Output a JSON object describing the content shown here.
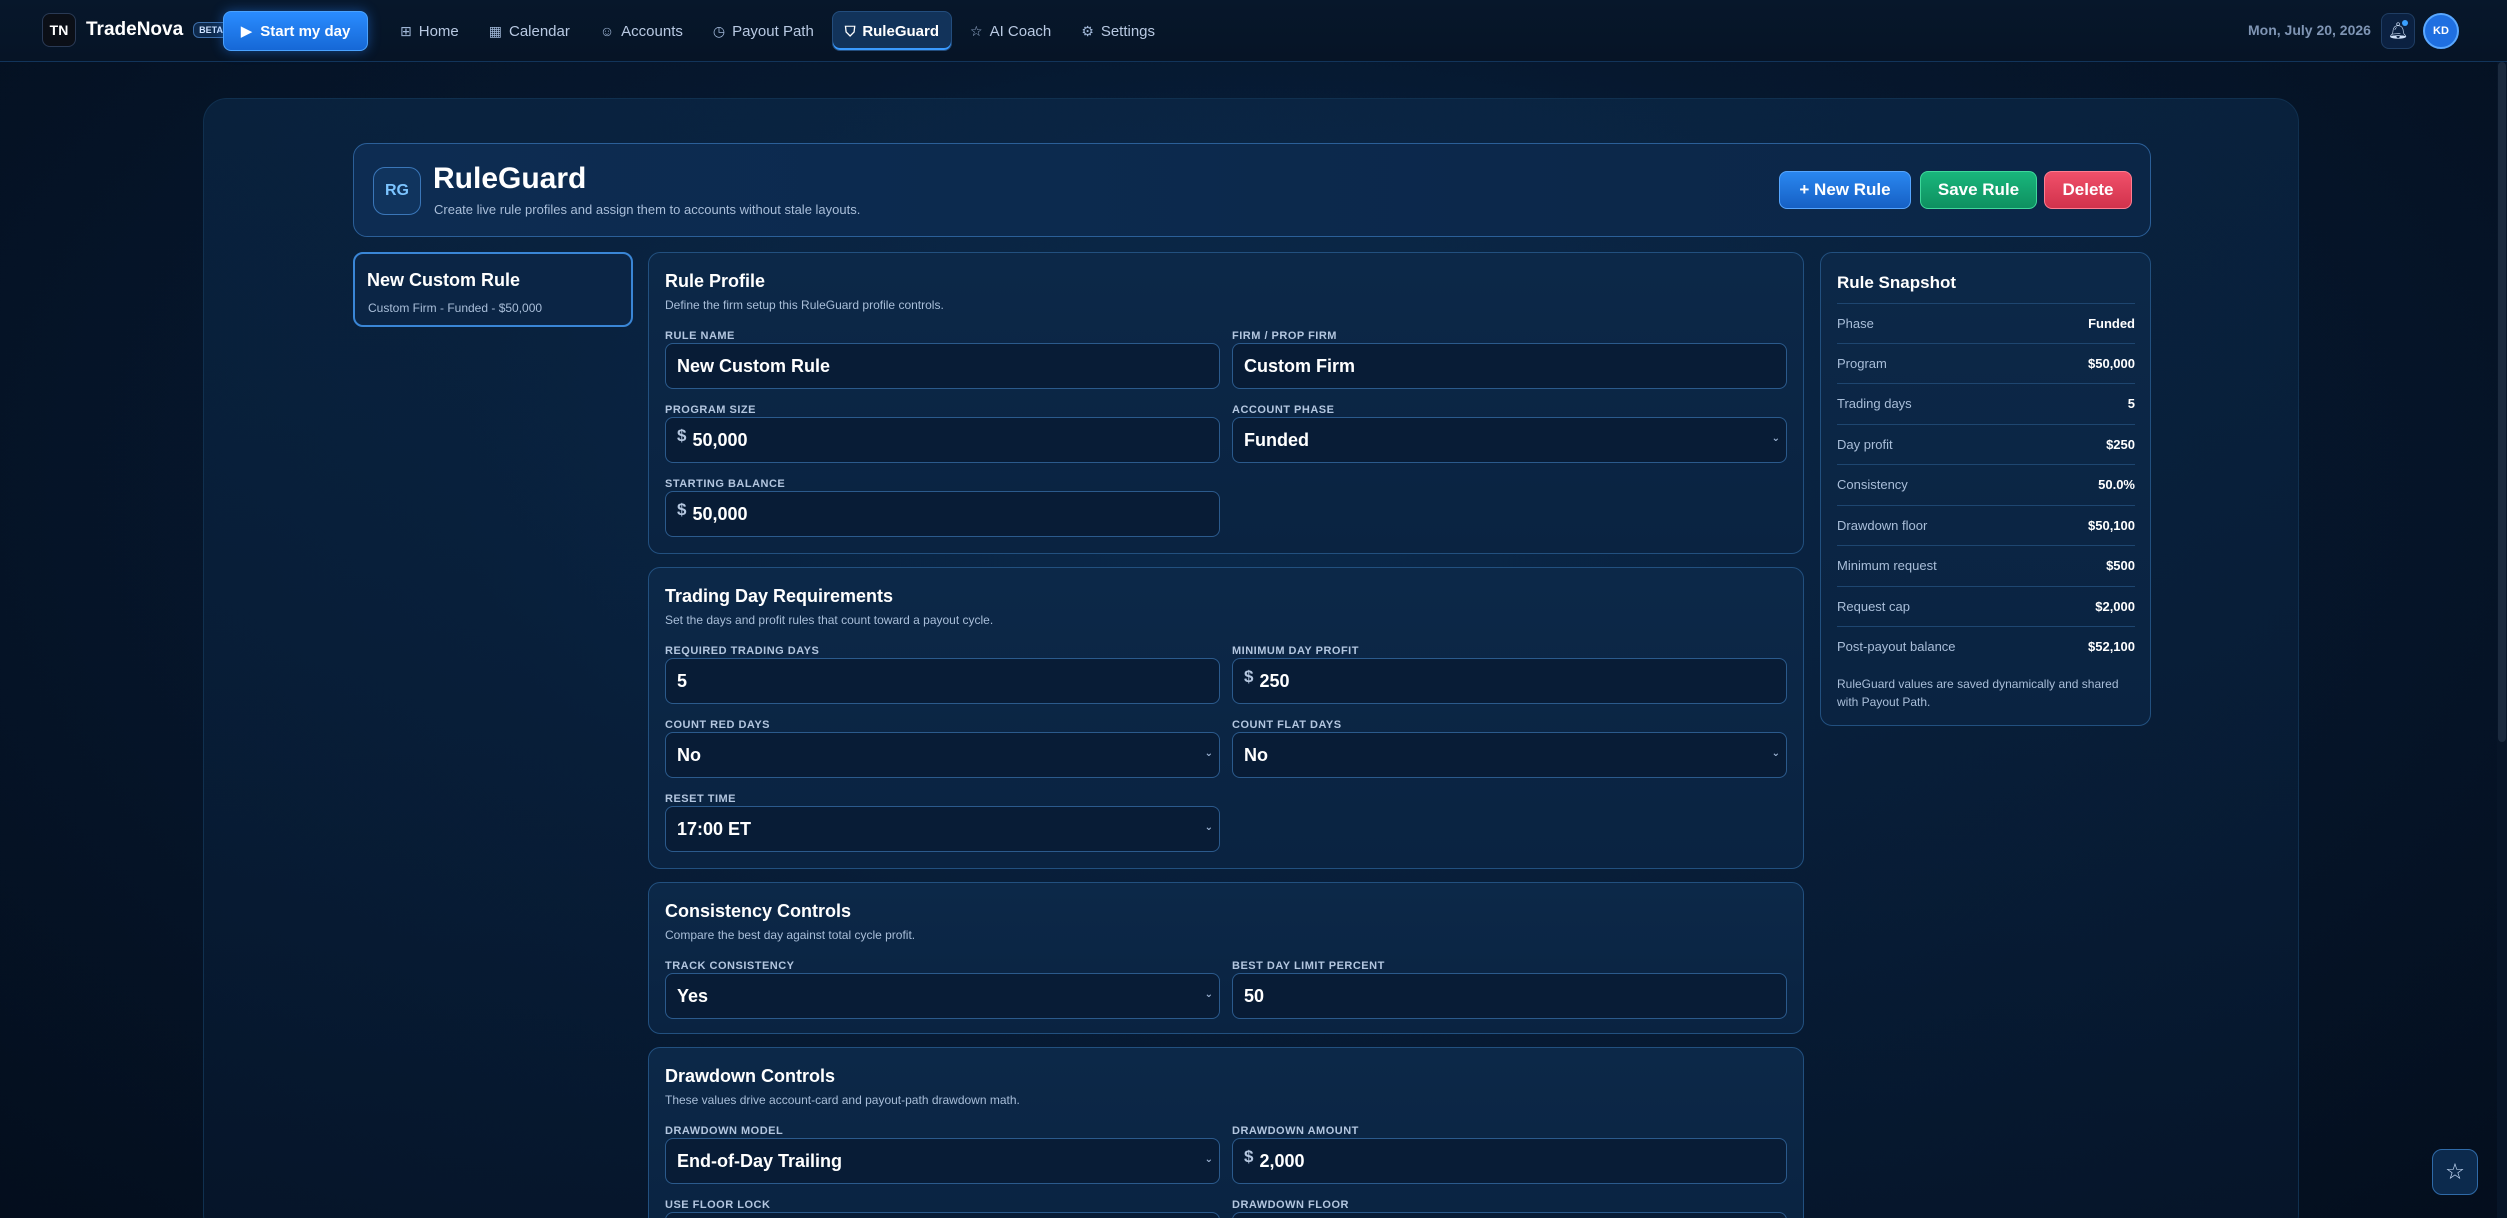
{
  "topbar": {
    "brand_name": "TradeNova",
    "beta": "BETA",
    "start_label": "Start my day",
    "nav": [
      {
        "label": "Home",
        "icon": "grid-icon"
      },
      {
        "label": "Calendar",
        "icon": "calendar-icon"
      },
      {
        "label": "Accounts",
        "icon": "users-icon"
      },
      {
        "label": "Payout Path",
        "icon": "clock-icon"
      },
      {
        "label": "RuleGuard",
        "icon": "shield-icon",
        "active": true
      },
      {
        "label": "AI Coach",
        "icon": "star-icon"
      },
      {
        "label": "Settings",
        "icon": "gear-icon"
      }
    ],
    "date": "Mon, July 20, 2026",
    "avatar_initials": "KD"
  },
  "header": {
    "badge": "RG",
    "title": "RuleGuard",
    "subtitle": "Create live rule profiles and assign them to accounts without stale layouts.",
    "new_rule_label": "+ New Rule",
    "save_rule_label": "Save Rule",
    "delete_label": "Delete"
  },
  "rule_list": [
    {
      "title": "New Custom Rule",
      "subtitle": "Custom Firm - Funded - $50,000"
    }
  ],
  "rule_profile": {
    "title": "Rule Profile",
    "subtitle": "Define the firm setup this RuleGuard profile controls.",
    "rule_name_label": "RULE NAME",
    "rule_name": "New Custom Rule",
    "firm_label": "FIRM / PROP FIRM",
    "firm": "Custom Firm",
    "program_size_label": "PROGRAM SIZE",
    "program_size": "50,000",
    "account_phase_label": "ACCOUNT PHASE",
    "account_phase": "Funded",
    "starting_balance_label": "STARTING BALANCE",
    "starting_balance": "50,000",
    "currency": "$"
  },
  "trading_day": {
    "title": "Trading Day Requirements",
    "subtitle": "Set the days and profit rules that count toward a payout cycle.",
    "required_days_label": "REQUIRED TRADING DAYS",
    "required_days": "5",
    "min_day_profit_label": "MINIMUM DAY PROFIT",
    "min_day_profit": "250",
    "count_red_label": "COUNT RED DAYS",
    "count_red": "No",
    "count_flat_label": "COUNT FLAT DAYS",
    "count_flat": "No",
    "reset_time_label": "RESET TIME",
    "reset_time": "17:00 ET"
  },
  "consistency": {
    "title": "Consistency Controls",
    "subtitle": "Compare the best day against total cycle profit.",
    "track_label": "TRACK CONSISTENCY",
    "track": "Yes",
    "best_day_label": "BEST DAY LIMIT PERCENT",
    "best_day": "50"
  },
  "drawdown": {
    "title": "Drawdown Controls",
    "subtitle": "These values drive account-card and payout-path drawdown math.",
    "model_label": "DRAWDOWN MODEL",
    "model": "End-of-Day Trailing",
    "amount_label": "DRAWDOWN AMOUNT",
    "amount": "2,000",
    "floor_lock_label": "USE FLOOR LOCK",
    "floor_label": "DRAWDOWN FLOOR"
  },
  "snapshot": {
    "title": "Rule Snapshot",
    "rows": [
      {
        "k": "Phase",
        "v": "Funded"
      },
      {
        "k": "Program",
        "v": "$50,000"
      },
      {
        "k": "Trading days",
        "v": "5"
      },
      {
        "k": "Day profit",
        "v": "$250"
      },
      {
        "k": "Consistency",
        "v": "50.0%"
      },
      {
        "k": "Drawdown floor",
        "v": "$50,100"
      },
      {
        "k": "Minimum request",
        "v": "$500"
      },
      {
        "k": "Request cap",
        "v": "$2,000"
      },
      {
        "k": "Post-payout balance",
        "v": "$52,100"
      }
    ],
    "note": "RuleGuard values are saved dynamically and shared with Payout Path."
  },
  "colors": {
    "accent": "#2a8cff",
    "save": "#19b67c",
    "delete": "#f0506a",
    "background": "#06182f"
  }
}
